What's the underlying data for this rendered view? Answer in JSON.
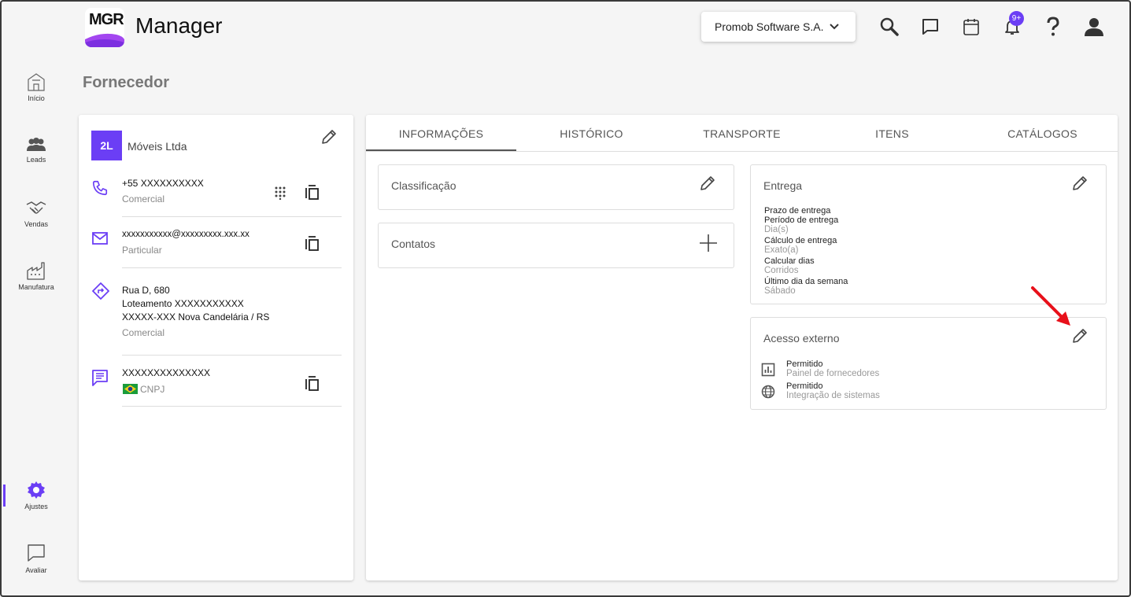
{
  "header": {
    "logo_text": "MGR",
    "app_title": "Manager",
    "company_select": "Promob Software S.A.",
    "notification_badge": "9+"
  },
  "sidebar": {
    "items": [
      {
        "label": "Início"
      },
      {
        "label": "Leads"
      },
      {
        "label": "Vendas"
      },
      {
        "label": "Manufatura"
      },
      {
        "label": "Ajustes"
      },
      {
        "label": "Avaliar"
      }
    ]
  },
  "page": {
    "title": "Fornecedor"
  },
  "supplier": {
    "avatar": "2L",
    "name": "Móveis Ltda",
    "phone": {
      "value": "+55 XXXXXXXXXX",
      "type": "Comercial"
    },
    "email": {
      "value": "xxxxxxxxxxx@xxxxxxxxx.xxx.xx",
      "type": "Particular"
    },
    "address": {
      "line1": "Rua D, 680",
      "line2": "Loteamento  XXXXXXXXXXX",
      "line3": "XXXXX-XXX Nova Candelária / RS",
      "type": "Comercial"
    },
    "document": {
      "value": "XXXXXXXXXXXXXX",
      "type": "CNPJ"
    }
  },
  "tabs": [
    "INFORMAÇÕES",
    "HISTÓRICO",
    "TRANSPORTE",
    "ITENS",
    "CATÁLOGOS"
  ],
  "classificacao": {
    "title": "Classificação"
  },
  "contatos": {
    "title": "Contatos"
  },
  "entrega": {
    "title": "Entrega",
    "fields": [
      {
        "label": "Prazo de entrega",
        "value": ""
      },
      {
        "label": "Período de entrega",
        "value": "Dia(s)"
      },
      {
        "label": "Cálculo de entrega",
        "value": "Exato(a)"
      },
      {
        "label": "Calcular dias",
        "value": "Corridos"
      },
      {
        "label": "Último dia da semana",
        "value": "Sábado"
      }
    ]
  },
  "acesso": {
    "title": "Acesso externo",
    "items": [
      {
        "status": "Permitido",
        "desc": "Painel de fornecedores"
      },
      {
        "status": "Permitido",
        "desc": "Integração de sistemas"
      }
    ]
  },
  "colors": {
    "accent": "#6b3ef5",
    "annotation_arrow": "#e8101a"
  }
}
